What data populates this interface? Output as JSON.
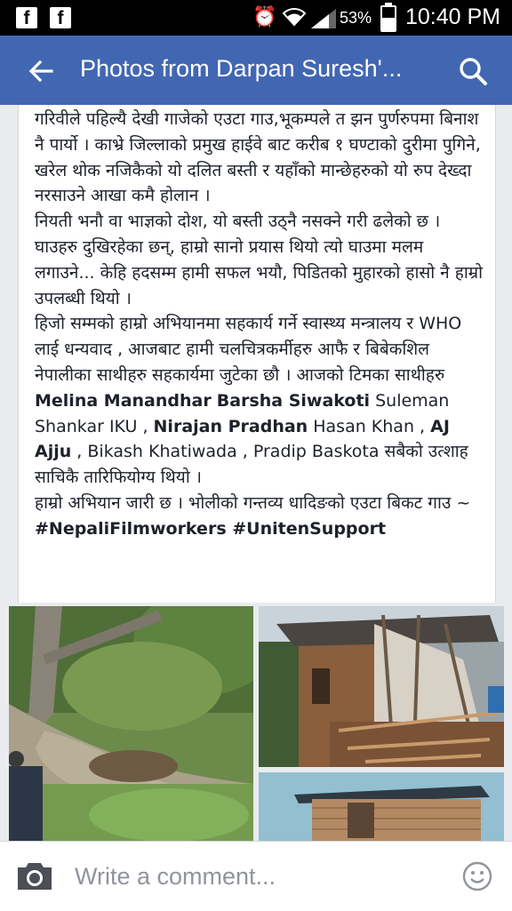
{
  "status_bar": {
    "left_icons": [
      "facebook-icon",
      "facebook-icon"
    ],
    "battery_percent": "53%",
    "battery_level": 0.53,
    "time": "10:40 PM"
  },
  "app_bar": {
    "title": "Photos from Darpan Suresh'...",
    "back_icon": "arrow-left-icon",
    "search_icon": "search-icon"
  },
  "post": {
    "paragraph1": "गरिवीले पहिल्यै देखी गाजेको एउटा गाउ,भूकम्पले त झन पुर्णरुपमा बिनाश नै पार्यो । काभ्रे जिल्लाको प्रमुख हाईवे बाट करीब १ घण्टाको दुरीमा पुगिने, खरेल थोक नजिकैको यो दलित बस्ती र यहाँको मान्छेहरुको यो रुप देख्दा नरसाउने आखा कमै होलान ।",
    "paragraph2": "नियती भनौ वा भाज्ञको दोश, यो बस्ती उठ्नै नसक्ने गरी ढलेको छ । घाउहरु दुखिरहेका छन्, हाम्रो सानो प्रयास थियो त्यो घाउमा मलम लगाउने...  केहि हदसम्म हामी सफल भयौ, पिडितको मुहारको हासो नै हाम्रो उपलब्धी थियो ।",
    "paragraph3_lead": "हिजो सम्मको हाम्रो अभियानमा सहकार्य गर्ने स्वास्थ्य मन्त्रालय र WHO लाई धन्यवाद , आजबाट हामी चलचित्रकर्मीहरु आफै  र बिबेकशिल नेपालीका साथीहरु सहकार्यमा जुटेका छौ । आजको टिमका साथीहरु ",
    "name_melina": "Melina Manandhar",
    "name_barsha": "Barsha Siwakoti",
    "text_suleman": " Suleman Shankar IKU , ",
    "name_nirajan": "Nirajan Pradhan",
    "text_hasan": " Hasan Khan , ",
    "name_aj": "AJ Ajju",
    "text_rest": " , Bikash Khatiwada , Pradip Baskota  सबैको उत्शाह साचिकै तारिफियोग्य थियो ।",
    "paragraph4": "हाम्रो अभियान जारी छ । भोलीको गन्तव्य धादिङको एउटा बिकट गाउ  ~",
    "hashtags": "#NepaliFilmworkers #UnitenSupport"
  },
  "photos": [
    "landslide-forest-photo",
    "collapsed-house-photo",
    "damaged-brick-house-photo"
  ],
  "comment_bar": {
    "placeholder": "Write a comment...",
    "camera_icon": "camera-icon",
    "emoji_icon": "smiley-icon"
  },
  "colors": {
    "app_bar": "#4267b2",
    "status_bar": "#000000",
    "background": "#e9ebee",
    "text": "#1d2129",
    "placeholder": "#90949c"
  }
}
